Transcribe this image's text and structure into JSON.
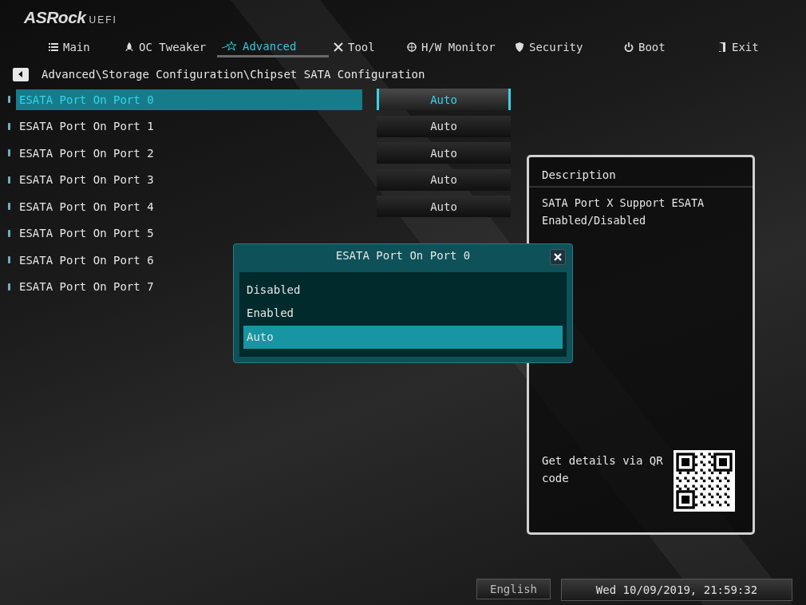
{
  "brand": {
    "logo": "ASRock",
    "suffix": "UEFI"
  },
  "tabs": [
    {
      "label": "Main",
      "selected": false
    },
    {
      "label": "OC Tweaker",
      "selected": false
    },
    {
      "label": "Advanced",
      "selected": true
    },
    {
      "label": "Tool",
      "selected": false
    },
    {
      "label": "H/W Monitor",
      "selected": false
    },
    {
      "label": "Security",
      "selected": false
    },
    {
      "label": "Boot",
      "selected": false
    },
    {
      "label": "Exit",
      "selected": false
    }
  ],
  "breadcrumb": "Advanced\\Storage Configuration\\Chipset SATA Configuration",
  "settings": [
    {
      "label": "ESATA Port On Port 0",
      "value": "Auto",
      "selected": true
    },
    {
      "label": "ESATA Port On Port 1",
      "value": "Auto",
      "selected": false
    },
    {
      "label": "ESATA Port On Port 2",
      "value": "Auto",
      "selected": false
    },
    {
      "label": "ESATA Port On Port 3",
      "value": "Auto",
      "selected": false
    },
    {
      "label": "ESATA Port On Port 4",
      "value": "Auto",
      "selected": false
    },
    {
      "label": "ESATA Port On Port 5",
      "selected": false
    },
    {
      "label": "ESATA Port On Port 6",
      "selected": false
    },
    {
      "label": "ESATA Port On Port 7",
      "selected": false
    }
  ],
  "description": {
    "title": "Description",
    "text": "SATA Port X Support ESATA Enabled/Disabled",
    "qr_text": "Get details via QR code"
  },
  "popup": {
    "title": "ESATA Port On Port 0",
    "options": [
      {
        "label": "Disabled",
        "selected": false
      },
      {
        "label": "Enabled",
        "selected": false
      },
      {
        "label": "Auto",
        "selected": true
      }
    ]
  },
  "footer": {
    "language": "English",
    "datetime": "Wed 10/09/2019, 21:59:32"
  }
}
